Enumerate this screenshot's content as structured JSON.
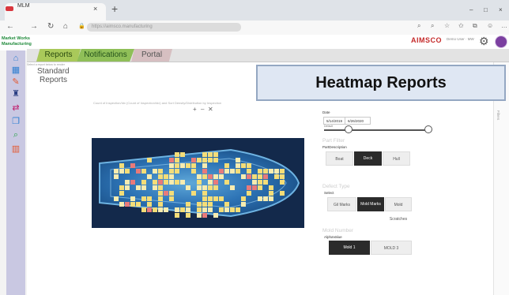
{
  "browser": {
    "tab_title": "MLM",
    "tab_close": "×",
    "new_tab": "+",
    "url": "https://aimsco.manufacturing",
    "win_minimize": "–",
    "win_maximize": "□",
    "win_close": "×",
    "nav_back": "←",
    "nav_forward": "→",
    "nav_reload": "↻",
    "nav_home": "⌂",
    "lock": "🔒"
  },
  "header": {
    "brand": "Market Works Manufacturing",
    "logo": "AIMSCO",
    "user": "Demo User · MW",
    "gear": "⚙"
  },
  "sidebar": {
    "items": [
      {
        "icon": "home-icon",
        "glyph": "⌂",
        "color": "#2f7fd1"
      },
      {
        "icon": "calendar-icon",
        "glyph": "▦",
        "color": "#2f7fd1"
      },
      {
        "icon": "wrench-icon",
        "glyph": "✎",
        "color": "#e4572e"
      },
      {
        "icon": "cup-icon",
        "glyph": "♜",
        "color": "#2b3e83"
      },
      {
        "icon": "transfer-icon",
        "glyph": "⇄",
        "color": "#c0206f"
      },
      {
        "icon": "copy-icon",
        "glyph": "❐",
        "color": "#2f7fd1"
      },
      {
        "icon": "search-icon",
        "glyph": "⌕",
        "color": "#2fa44f"
      },
      {
        "icon": "chart-icon",
        "glyph": "▥",
        "color": "#e4572e"
      }
    ]
  },
  "tabs": {
    "reports": "Reports",
    "notifications": "Notifications",
    "portal": "Portal"
  },
  "page": {
    "hint": "Select a report below to render",
    "title_line1": "Standard",
    "title_line2": "Reports",
    "chart_title": "Count of Inspection/Idx (Count of Inspection/Idx) and Sort Density/Distribution by Inspection",
    "zoom_plus": "+",
    "zoom_minus": "–",
    "zoom_reset": "✕",
    "banner": "Heatmap Reports",
    "right_label": "Filters"
  },
  "filters": {
    "date_label": "Date",
    "date_from": "5/14/2019",
    "date_to": "6/26/2020",
    "date_sub": "Default",
    "part_filter_title": "Part Filter",
    "part_sub": "PartDescription",
    "part_options": [
      "Boat",
      "Deck",
      "Hull"
    ],
    "part_selected": 1,
    "defect_title": "Defect Type",
    "defect_sub": "Select",
    "defect_options": [
      "Gil Marks",
      "Mold Marks",
      "Mold Scratches"
    ],
    "defect_selected": 1,
    "mold_title": "Mold Number",
    "mold_sub": "AlphaValue",
    "mold_options": [
      "Mold 1",
      "MOLD 3"
    ],
    "mold_selected": 0
  },
  "colors": {
    "heat_low": "#1a4f86",
    "heat_mid": "#f4dd78",
    "heat_high": "#e87a7a",
    "sidebar_bg": "#c9c8e2",
    "banner_bg": "#dfe7f3"
  }
}
